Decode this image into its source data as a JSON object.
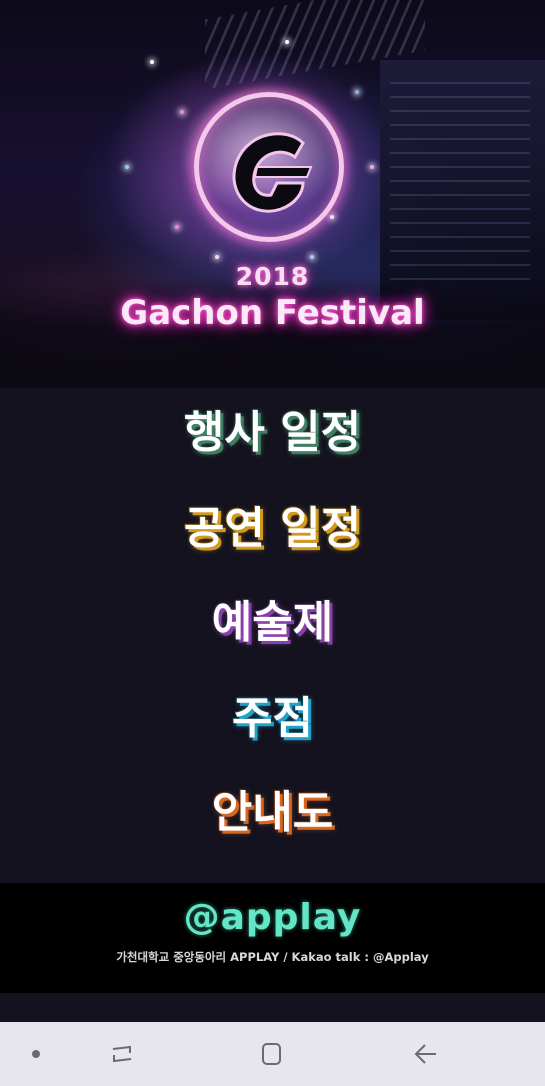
{
  "hero": {
    "year": "2018",
    "title": "Gachon Festival",
    "logo_icon": "gachon-g-logo-icon",
    "accent_color": "#ff63d4"
  },
  "menu": {
    "items": [
      {
        "label": "행사 일정",
        "shadow_color": "#3f7f63"
      },
      {
        "label": "공연 일정",
        "shadow_color": "#d19a1f"
      },
      {
        "label": "예술제",
        "shadow_color": "#8a3fae"
      },
      {
        "label": "주점",
        "shadow_color": "#1fa3c9"
      },
      {
        "label": "안내도",
        "shadow_color": "#d9661f"
      }
    ]
  },
  "footer": {
    "logo_text": "@applay",
    "logo_color": "#62e6c6",
    "credit": "가천대학교 중앙동아리 APPLAY / Kakao talk : @Applay"
  },
  "navbar": {
    "buttons": [
      "dot-icon",
      "recent-apps-icon",
      "home-icon",
      "back-icon"
    ]
  }
}
